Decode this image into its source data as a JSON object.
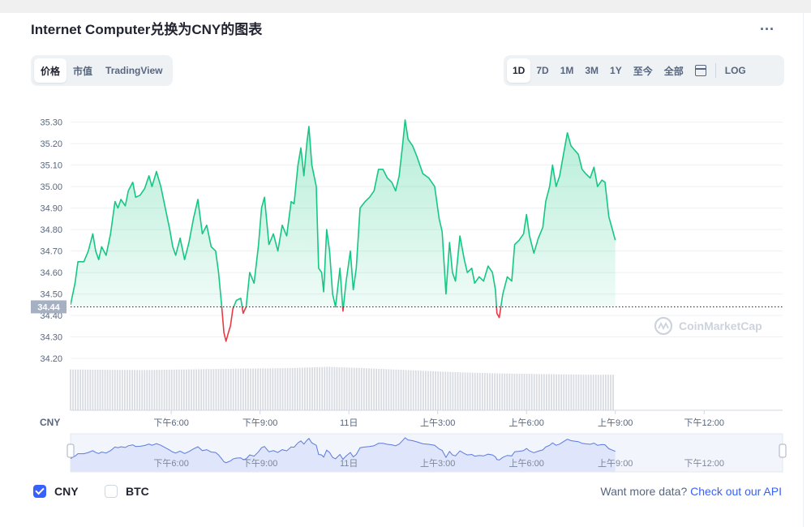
{
  "title": "Internet Computer兑换为CNY的图表",
  "more_label": "...",
  "tabs_left": [
    {
      "label": "价格",
      "active": true
    },
    {
      "label": "市值",
      "active": false
    },
    {
      "label": "TradingView",
      "active": false
    }
  ],
  "tabs_right": [
    {
      "label": "1D",
      "active": true
    },
    {
      "label": "7D",
      "active": false
    },
    {
      "label": "1M",
      "active": false
    },
    {
      "label": "3M",
      "active": false
    },
    {
      "label": "1Y",
      "active": false
    },
    {
      "label": "至今",
      "active": false
    },
    {
      "label": "全部",
      "active": false
    }
  ],
  "log_label": "LOG",
  "watermark": "CoinMarketCap",
  "legend": {
    "cny": {
      "label": "CNY",
      "checked": true
    },
    "btc": {
      "label": "BTC",
      "checked": false
    }
  },
  "api": {
    "text": "Want more data?",
    "link": "Check out our API"
  },
  "colors": {
    "up": "#16c784",
    "down": "#ea3943",
    "accent": "#3861fb",
    "navigator_line": "#5b7be0",
    "navigator_fill": "#dfe5fb"
  },
  "chart_data": {
    "type": "line",
    "title": "",
    "ylabel": "",
    "unit_label": "CNY",
    "ylim": [
      34.17,
      35.34
    ],
    "yticks": [
      34.2,
      34.3,
      34.4,
      34.5,
      34.6,
      34.7,
      34.8,
      34.9,
      35.0,
      35.1,
      35.2,
      35.3
    ],
    "ytick_labels": [
      "34.20",
      "34.30",
      "34.40",
      "34.50",
      "34.60",
      "34.70",
      "34.80",
      "34.90",
      "35.00",
      "35.10",
      "35.20",
      "35.30"
    ],
    "baseline": 34.44,
    "baseline_label": "34.44",
    "xlim": [
      14.6,
      38.65
    ],
    "xticks": [
      {
        "h": 18,
        "label": "下午6:00"
      },
      {
        "h": 21,
        "label": "下午9:00"
      },
      {
        "h": 24,
        "label": "11日"
      },
      {
        "h": 27,
        "label": "上午3:00"
      },
      {
        "h": 30,
        "label": "上午6:00"
      },
      {
        "h": 33,
        "label": "上午9:00"
      },
      {
        "h": 36,
        "label": "下午12:00"
      }
    ],
    "price": [
      [
        14.6,
        34.45
      ],
      [
        14.75,
        34.55
      ],
      [
        14.85,
        34.65
      ],
      [
        15.05,
        34.65
      ],
      [
        15.2,
        34.7
      ],
      [
        15.35,
        34.78
      ],
      [
        15.45,
        34.7
      ],
      [
        15.55,
        34.66
      ],
      [
        15.65,
        34.72
      ],
      [
        15.8,
        34.68
      ],
      [
        15.95,
        34.78
      ],
      [
        16.1,
        34.93
      ],
      [
        16.2,
        34.9
      ],
      [
        16.3,
        34.94
      ],
      [
        16.45,
        34.91
      ],
      [
        16.55,
        34.98
      ],
      [
        16.7,
        35.02
      ],
      [
        16.8,
        34.95
      ],
      [
        16.95,
        34.96
      ],
      [
        17.1,
        34.99
      ],
      [
        17.25,
        35.05
      ],
      [
        17.35,
        35.0
      ],
      [
        17.5,
        35.07
      ],
      [
        17.65,
        35.0
      ],
      [
        17.8,
        34.9
      ],
      [
        17.95,
        34.8
      ],
      [
        18.05,
        34.72
      ],
      [
        18.15,
        34.68
      ],
      [
        18.3,
        34.76
      ],
      [
        18.45,
        34.66
      ],
      [
        18.6,
        34.74
      ],
      [
        18.75,
        34.85
      ],
      [
        18.9,
        34.94
      ],
      [
        19.05,
        34.78
      ],
      [
        19.2,
        34.82
      ],
      [
        19.35,
        34.72
      ],
      [
        19.5,
        34.7
      ],
      [
        19.6,
        34.6
      ],
      [
        19.7,
        34.45
      ],
      [
        19.78,
        34.32
      ],
      [
        19.85,
        34.28
      ],
      [
        19.93,
        34.32
      ],
      [
        20.0,
        34.35
      ],
      [
        20.08,
        34.43
      ],
      [
        20.2,
        34.47
      ],
      [
        20.35,
        34.48
      ],
      [
        20.43,
        34.41
      ],
      [
        20.53,
        34.44
      ],
      [
        20.65,
        34.6
      ],
      [
        20.8,
        34.55
      ],
      [
        20.95,
        34.73
      ],
      [
        21.05,
        34.9
      ],
      [
        21.15,
        34.95
      ],
      [
        21.3,
        34.73
      ],
      [
        21.45,
        34.78
      ],
      [
        21.6,
        34.7
      ],
      [
        21.75,
        34.82
      ],
      [
        21.9,
        34.77
      ],
      [
        22.05,
        34.93
      ],
      [
        22.15,
        34.92
      ],
      [
        22.28,
        35.1
      ],
      [
        22.38,
        35.18
      ],
      [
        22.48,
        35.05
      ],
      [
        22.58,
        35.2
      ],
      [
        22.65,
        35.28
      ],
      [
        22.75,
        35.1
      ],
      [
        22.9,
        35.0
      ],
      [
        22.98,
        34.62
      ],
      [
        23.08,
        34.6
      ],
      [
        23.15,
        34.51
      ],
      [
        23.25,
        34.8
      ],
      [
        23.35,
        34.7
      ],
      [
        23.45,
        34.5
      ],
      [
        23.55,
        34.44
      ],
      [
        23.7,
        34.62
      ],
      [
        23.8,
        34.42
      ],
      [
        23.9,
        34.55
      ],
      [
        24.05,
        34.7
      ],
      [
        24.15,
        34.52
      ],
      [
        24.25,
        34.62
      ],
      [
        24.38,
        34.9
      ],
      [
        24.55,
        34.93
      ],
      [
        24.7,
        34.95
      ],
      [
        24.85,
        34.98
      ],
      [
        25.0,
        35.08
      ],
      [
        25.15,
        35.08
      ],
      [
        25.3,
        35.04
      ],
      [
        25.45,
        35.02
      ],
      [
        25.58,
        34.98
      ],
      [
        25.7,
        35.05
      ],
      [
        25.82,
        35.2
      ],
      [
        25.9,
        35.31
      ],
      [
        26.0,
        35.22
      ],
      [
        26.15,
        35.19
      ],
      [
        26.3,
        35.14
      ],
      [
        26.5,
        35.06
      ],
      [
        26.7,
        35.04
      ],
      [
        26.9,
        35.0
      ],
      [
        27.05,
        34.85
      ],
      [
        27.15,
        34.79
      ],
      [
        27.28,
        34.5
      ],
      [
        27.4,
        34.74
      ],
      [
        27.5,
        34.6
      ],
      [
        27.6,
        34.56
      ],
      [
        27.75,
        34.77
      ],
      [
        27.9,
        34.66
      ],
      [
        28.0,
        34.6
      ],
      [
        28.15,
        34.62
      ],
      [
        28.25,
        34.55
      ],
      [
        28.4,
        34.58
      ],
      [
        28.55,
        34.56
      ],
      [
        28.7,
        34.63
      ],
      [
        28.85,
        34.6
      ],
      [
        28.95,
        34.52
      ],
      [
        29.0,
        34.41
      ],
      [
        29.08,
        34.39
      ],
      [
        29.2,
        34.5
      ],
      [
        29.35,
        34.58
      ],
      [
        29.5,
        34.56
      ],
      [
        29.6,
        34.73
      ],
      [
        29.75,
        34.75
      ],
      [
        29.9,
        34.78
      ],
      [
        30.0,
        34.87
      ],
      [
        30.1,
        34.77
      ],
      [
        30.25,
        34.69
      ],
      [
        30.4,
        34.76
      ],
      [
        30.55,
        34.81
      ],
      [
        30.65,
        34.93
      ],
      [
        30.78,
        35.0
      ],
      [
        30.88,
        35.1
      ],
      [
        31.0,
        35.0
      ],
      [
        31.12,
        35.05
      ],
      [
        31.25,
        35.15
      ],
      [
        31.38,
        35.25
      ],
      [
        31.5,
        35.19
      ],
      [
        31.62,
        35.17
      ],
      [
        31.75,
        35.15
      ],
      [
        31.88,
        35.08
      ],
      [
        32.0,
        35.06
      ],
      [
        32.15,
        35.04
      ],
      [
        32.28,
        35.09
      ],
      [
        32.4,
        35.0
      ],
      [
        32.55,
        35.03
      ],
      [
        32.65,
        35.02
      ],
      [
        32.78,
        34.86
      ],
      [
        32.9,
        34.8
      ],
      [
        33.0,
        34.75
      ]
    ],
    "volume": [
      [
        14.6,
        0.62
      ],
      [
        17.0,
        0.61
      ],
      [
        20.0,
        0.63
      ],
      [
        22.0,
        0.64
      ],
      [
        23.3,
        0.66
      ],
      [
        24.5,
        0.64
      ],
      [
        26.0,
        0.61
      ],
      [
        27.5,
        0.58
      ],
      [
        29.0,
        0.56
      ],
      [
        30.5,
        0.55
      ],
      [
        32.0,
        0.54
      ],
      [
        33.0,
        0.54
      ]
    ],
    "navigator_xticks": [
      {
        "h": 18,
        "label": "下午6:00"
      },
      {
        "h": 21,
        "label": "下午9:00"
      },
      {
        "h": 24,
        "label": "11日"
      },
      {
        "h": 27,
        "label": "上午3:00"
      },
      {
        "h": 30,
        "label": "上午6:00"
      },
      {
        "h": 33,
        "label": "上午9:00"
      },
      {
        "h": 36,
        "label": "下午12:00"
      }
    ]
  }
}
